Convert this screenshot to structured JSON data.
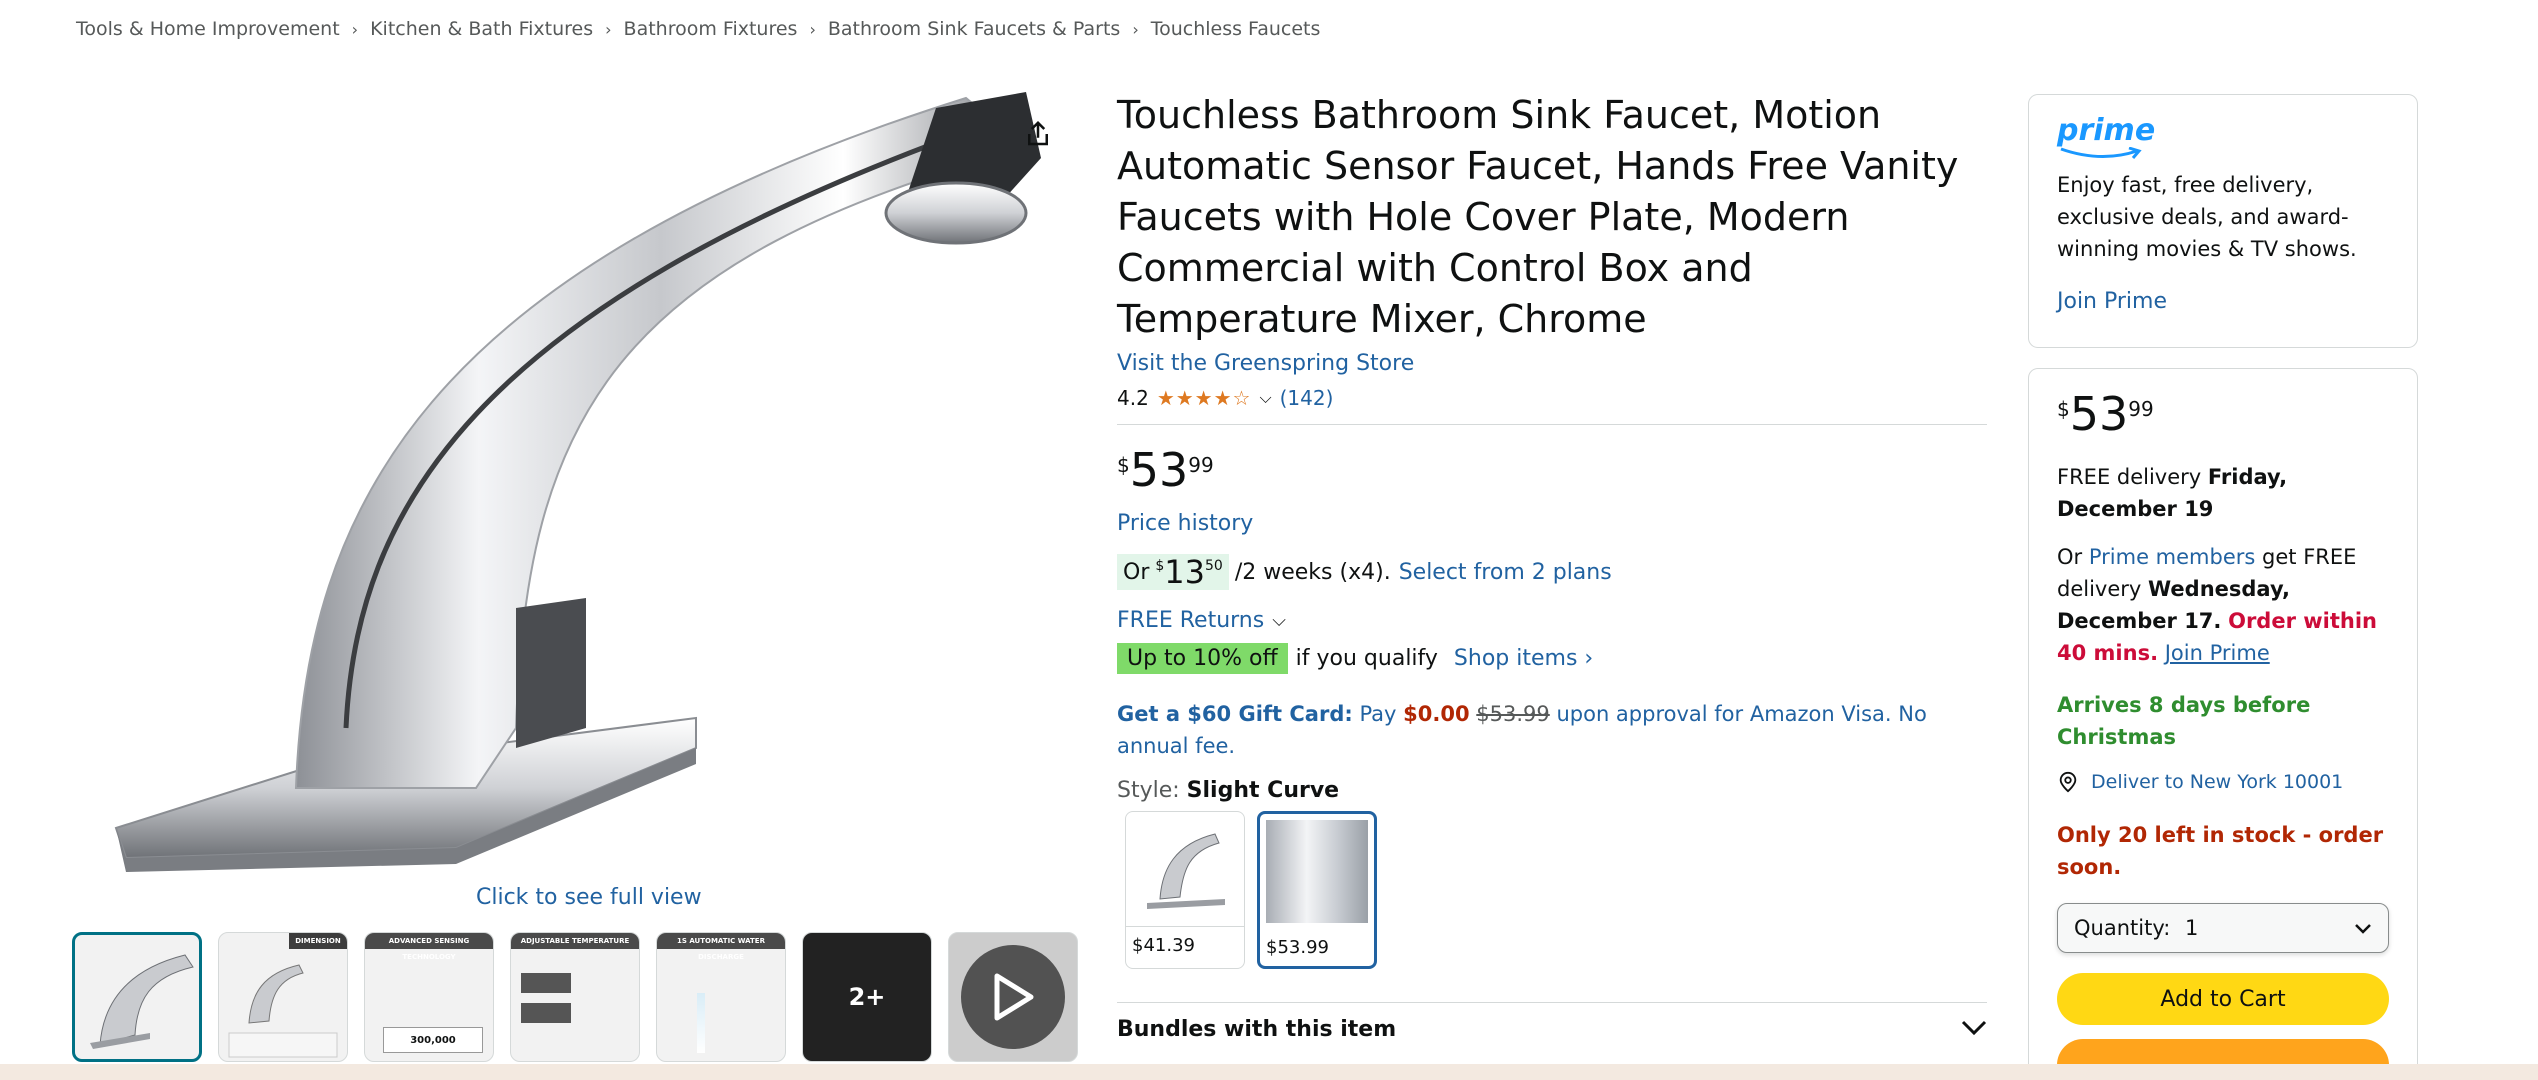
{
  "breadcrumb": [
    "Tools & Home Improvement",
    "Kitchen & Bath Fixtures",
    "Bathroom Fixtures",
    "Bathroom Sink Faucets & Parts",
    "Touchless Faucets"
  ],
  "gallery": {
    "full_view_label": "Click to see full view",
    "thumbs": [
      {
        "label": ""
      },
      {
        "label": "DIMENSION"
      },
      {
        "label": "ADVANCED SENSING TECHNOLOGY"
      },
      {
        "label": "ADJUSTABLE TEMPERATURE"
      },
      {
        "label": "1S AUTOMATIC WATER DISCHARGE"
      },
      {
        "label": "2+"
      },
      {
        "label": ""
      }
    ],
    "thumb_badge_300000": "300,000"
  },
  "product": {
    "title": "Touchless Bathroom Sink Faucet, Motion Automatic Sensor Faucet, Hands Free Vanity Faucets with Hole Cover Plate, Modern Commercial with Control Box and Temperature Mixer, Chrome",
    "store_link": "Visit the Greenspring Store",
    "rating": "4.2",
    "stars": "★★★★☆",
    "review_count": "(142)",
    "price_symbol": "$",
    "price_whole": "53",
    "price_fraction": "99",
    "price_history": "Price history",
    "installment_prefix": "Or",
    "installment_symbol": "$",
    "installment_whole": "13",
    "installment_fraction": "50",
    "installment_suffix": "/2 weeks (x4).",
    "installment_link": "Select from 2 plans",
    "returns": "FREE Returns",
    "promo_badge": "Up to 10% off",
    "promo_text": "if you qualify",
    "shop_items": "Shop items ›",
    "gift_bold": "Get a $60 Gift Card:",
    "gift_pay": "Pay",
    "gift_red": "$0.00",
    "gift_strike": "$53.99",
    "gift_rest": "upon approval for Amazon Visa. No annual fee.",
    "style_label": "Style:",
    "style_value": "Slight Curve",
    "swatches": [
      {
        "price": "$41.39"
      },
      {
        "price": "$53.99"
      }
    ],
    "bundles": "Bundles with this item"
  },
  "prime": {
    "logo": "prime",
    "text": "Enjoy fast, free delivery, exclusive deals, and award-winning movies & TV shows.",
    "join": "Join Prime"
  },
  "buybox": {
    "price_symbol": "$",
    "price_whole": "53",
    "price_fraction": "99",
    "delivery_prefix": "FREE delivery",
    "delivery_date": "Friday, December 19",
    "prime_prefix": "Or",
    "prime_members": "Prime members",
    "prime_mid": "get FREE delivery",
    "prime_date": "Wednesday, December 17",
    "order_within": "Order within 40 mins.",
    "join_prime": "Join Prime",
    "arrives": "Arrives 8 days before Christmas",
    "deliver_to": "Deliver to New York 10001",
    "stock": "Only 20 left in stock - order soon.",
    "qty_label": "Quantity:",
    "qty_value": "1",
    "add_to_cart": "Add to Cart"
  }
}
